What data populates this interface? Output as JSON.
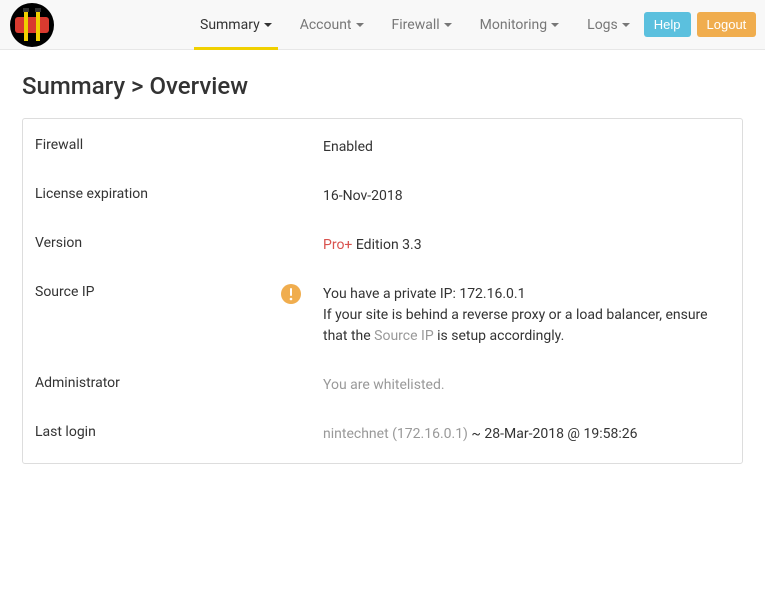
{
  "nav": {
    "items": [
      {
        "label": "Summary",
        "active": true
      },
      {
        "label": "Account",
        "active": false
      },
      {
        "label": "Firewall",
        "active": false
      },
      {
        "label": "Monitoring",
        "active": false
      },
      {
        "label": "Logs",
        "active": false
      }
    ],
    "help_label": "Help",
    "logout_label": "Logout"
  },
  "page": {
    "title": "Summary > Overview"
  },
  "summary": {
    "firewall": {
      "label": "Firewall",
      "value": "Enabled"
    },
    "license": {
      "label": "License expiration",
      "value": "16-Nov-2018"
    },
    "version": {
      "label": "Version",
      "edition_prefix": "Pro+",
      "edition_suffix": " Edition 3.3"
    },
    "source_ip": {
      "label": "Source IP",
      "line1": "You have a private IP: 172.16.0.1",
      "line2a": "If your site is behind a reverse proxy or a load balancer, ensure that the ",
      "link": "Source IP",
      "line2b": " is setup accordingly."
    },
    "admin": {
      "label": "Administrator",
      "value": "You are whitelisted."
    },
    "last_login": {
      "label": "Last login",
      "user": "nintechnet (172.16.0.1)",
      "sep_time": " ~ 28-Mar-2018 @ 19:58:26"
    }
  }
}
